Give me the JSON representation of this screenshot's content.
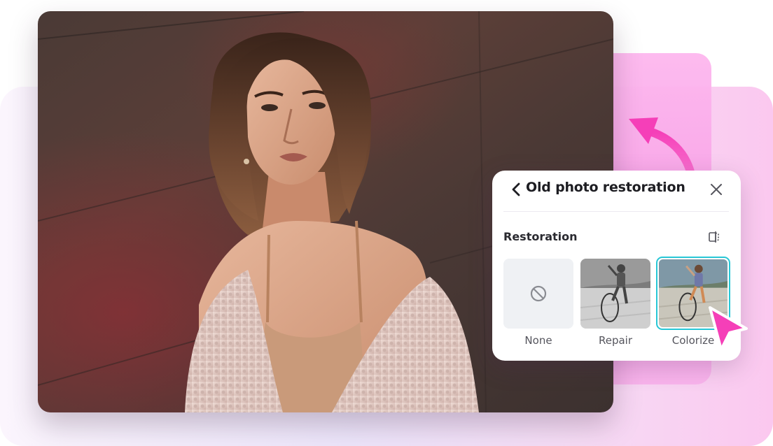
{
  "panel": {
    "title": "Old photo restoration",
    "section_title": "Restoration",
    "options": [
      {
        "label": "None",
        "selected": false
      },
      {
        "label": "Repair",
        "selected": false
      },
      {
        "label": "Colorize",
        "selected": true
      }
    ]
  },
  "icons": {
    "back": "chevron-left-icon",
    "close": "close-icon",
    "compare": "compare-icon",
    "none": "no-symbol-icon",
    "cursor": "cursor-pointer-icon",
    "arrow": "curved-arrow-icon"
  },
  "colors": {
    "accent_pink": "#f53fb8",
    "selection_border": "#27c7d6",
    "panel_bg": "#ffffff",
    "title_text": "#1d1d22",
    "option_label": "#55555d"
  }
}
